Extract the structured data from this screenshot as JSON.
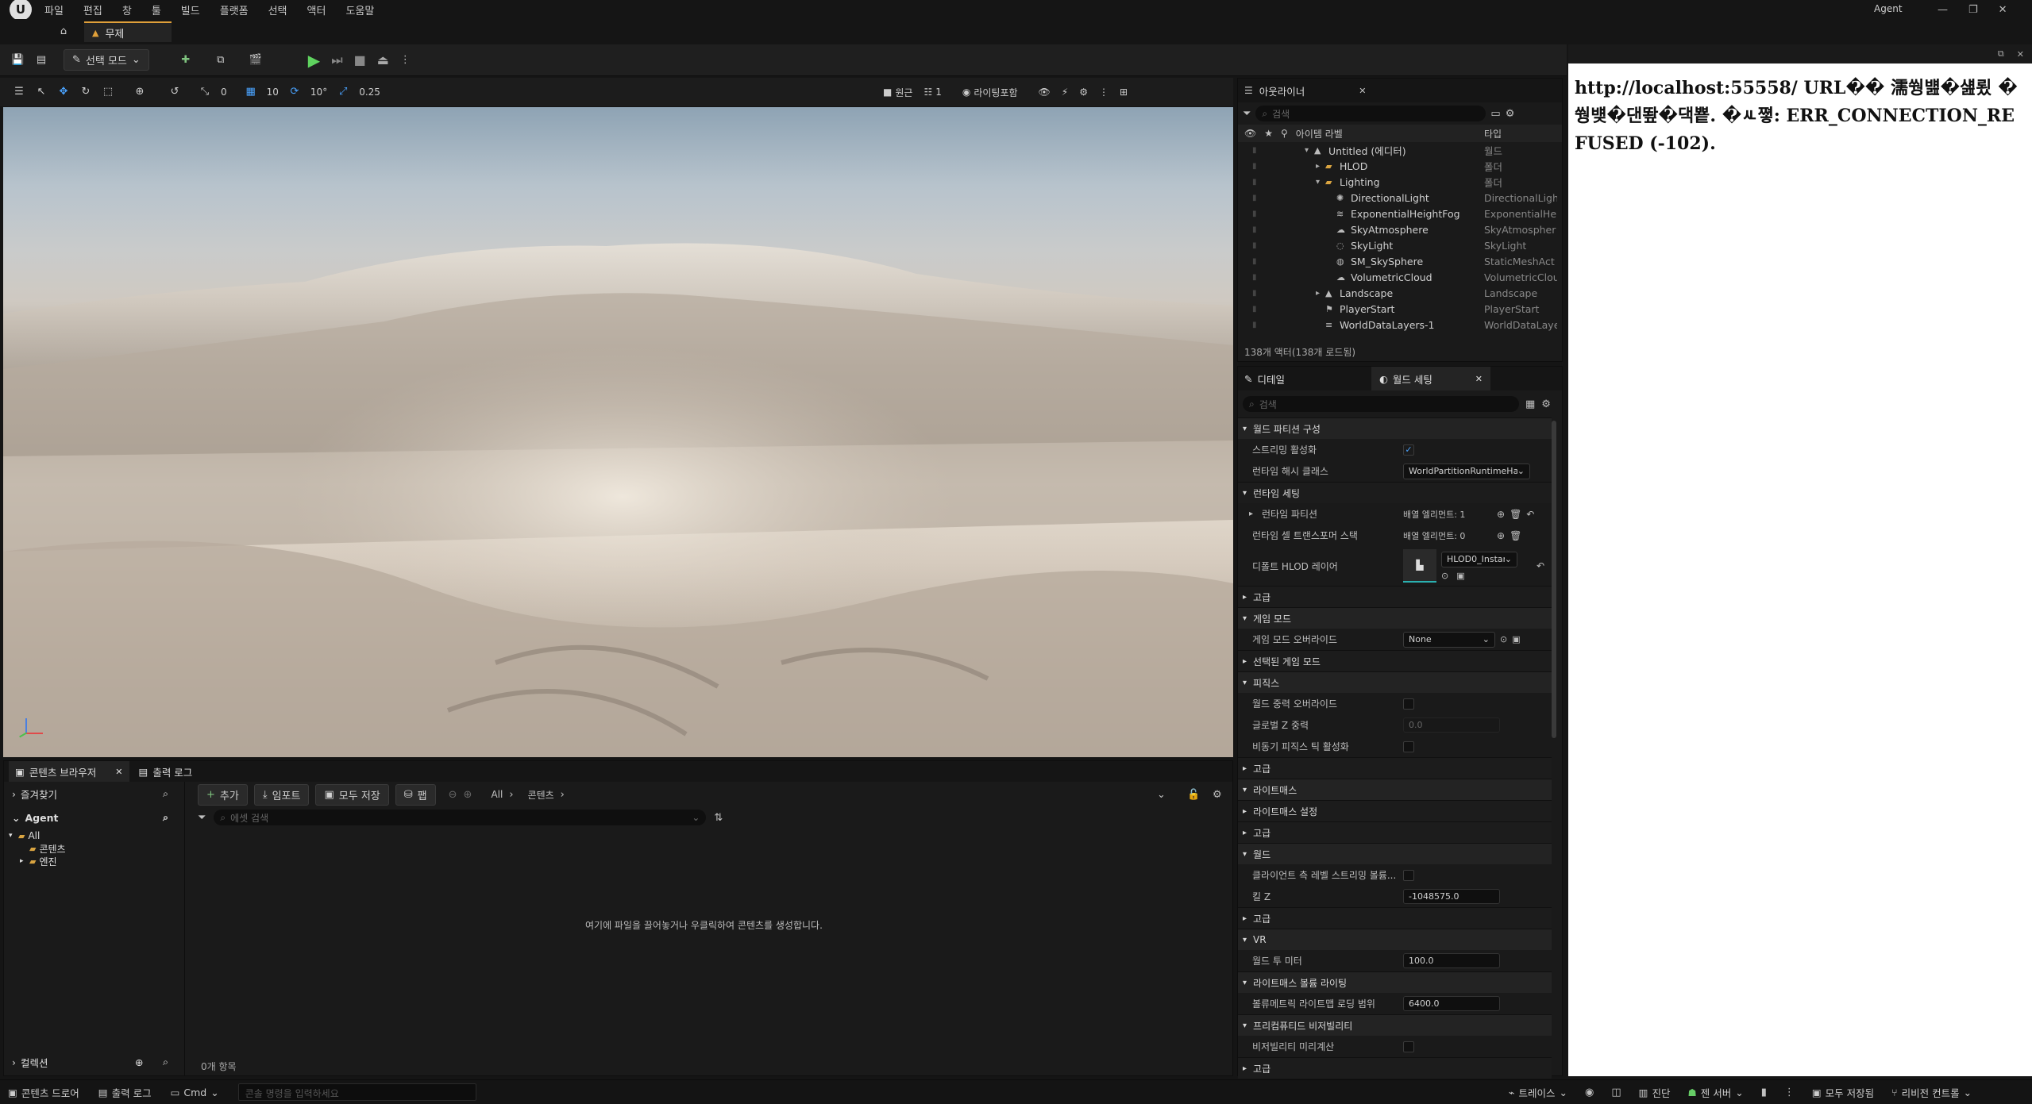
{
  "menu": [
    "파일",
    "편집",
    "창",
    "툴",
    "빌드",
    "플랫폼",
    "선택",
    "액터",
    "도움말"
  ],
  "window": {
    "user": "Agent",
    "level_tab": "무제"
  },
  "toolbar": {
    "mode_label": "선택 모드"
  },
  "viewport_toolbar": {
    "snap_move": "10",
    "snap_rotate": "10°",
    "snap_scale": "0.25",
    "cam_speed": "0",
    "perspective": "원근",
    "view_count": "1",
    "view_mode": "라이팅포함"
  },
  "outliner": {
    "tab_title": "아웃라이너",
    "search_placeholder": "검색",
    "col_label": "아이템 라벨",
    "col_type": "타입",
    "items": [
      {
        "label": "Untitled (에디터)",
        "type": "월드",
        "indent": 0,
        "icon": "world-icon",
        "exp": "down"
      },
      {
        "label": "HLOD",
        "type": "폴더",
        "indent": 1,
        "icon": "folder-icon",
        "exp": "right"
      },
      {
        "label": "Lighting",
        "type": "폴더",
        "indent": 1,
        "icon": "folder-icon",
        "exp": "down"
      },
      {
        "label": "DirectionalLight",
        "type": "DirectionalLight",
        "indent": 2,
        "icon": "sun-icon",
        "exp": ""
      },
      {
        "label": "ExponentialHeightFog",
        "type": "ExponentialHei",
        "indent": 2,
        "icon": "fog-icon",
        "exp": ""
      },
      {
        "label": "SkyAtmosphere",
        "type": "SkyAtmospher",
        "indent": 2,
        "icon": "atmosphere-icon",
        "exp": ""
      },
      {
        "label": "SkyLight",
        "type": "SkyLight",
        "indent": 2,
        "icon": "skylight-icon",
        "exp": ""
      },
      {
        "label": "SM_SkySphere",
        "type": "StaticMeshAct",
        "indent": 2,
        "icon": "mesh-icon",
        "exp": ""
      },
      {
        "label": "VolumetricCloud",
        "type": "VolumetricClou",
        "indent": 2,
        "icon": "cloud-icon",
        "exp": ""
      },
      {
        "label": "Landscape",
        "type": "Landscape",
        "indent": 1,
        "icon": "landscape-icon",
        "exp": "right"
      },
      {
        "label": "PlayerStart",
        "type": "PlayerStart",
        "indent": 1,
        "icon": "player-icon",
        "exp": ""
      },
      {
        "label": "WorldDataLayers-1",
        "type": "WorldDataLaye",
        "indent": 1,
        "icon": "layers-icon",
        "exp": ""
      }
    ],
    "footer": "138개 액터(138개 로드됨)"
  },
  "details": {
    "tab_details": "디테일",
    "tab_world": "월드 세팅",
    "search_placeholder": "검색",
    "rows": [
      {
        "kind": "cat",
        "label": "월드 파티션 구성",
        "open": true
      },
      {
        "kind": "prop",
        "label": "스트리밍 활성화",
        "ctrl": "checkbox",
        "checked": true
      },
      {
        "kind": "prop",
        "label": "런타임 해시 클래스",
        "ctrl": "dropdown",
        "value": "WorldPartitionRuntimeHa"
      },
      {
        "kind": "sub",
        "label": "런타임 세팅",
        "open": true
      },
      {
        "kind": "prop",
        "label": "런타임 파티션",
        "ctrl": "array",
        "value": "배열 엘리먼트: 1",
        "expandable": true
      },
      {
        "kind": "prop",
        "label": "런타임 셀 트랜스포머 스택",
        "ctrl": "array",
        "value": "배열 엘리먼트: 0"
      },
      {
        "kind": "prop-tall",
        "label": "디폴트 HLOD 레이어",
        "ctrl": "asset",
        "value": "HLOD0_Instan"
      },
      {
        "kind": "sub",
        "label": "고급",
        "open": false
      },
      {
        "kind": "cat",
        "label": "게임 모드",
        "open": true
      },
      {
        "kind": "prop",
        "label": "게임 모드 오버라이드",
        "ctrl": "dropdown-sm",
        "value": "None"
      },
      {
        "kind": "sub",
        "label": "선택된 게임 모드",
        "open": false
      },
      {
        "kind": "cat",
        "label": "피직스",
        "open": true
      },
      {
        "kind": "prop",
        "label": "월드 중력 오버라이드",
        "ctrl": "checkbox",
        "checked": false
      },
      {
        "kind": "prop",
        "label": "글로벌 Z 중력",
        "ctrl": "field-dim",
        "value": "0.0"
      },
      {
        "kind": "prop",
        "label": "비동기 피직스 틱 활성화",
        "ctrl": "checkbox",
        "checked": false
      },
      {
        "kind": "sub",
        "label": "고급",
        "open": false
      },
      {
        "kind": "cat",
        "label": "라이트매스",
        "open": true
      },
      {
        "kind": "sub",
        "label": "라이트매스 설정",
        "open": false
      },
      {
        "kind": "sub",
        "label": "고급",
        "open": false
      },
      {
        "kind": "cat",
        "label": "월드",
        "open": true
      },
      {
        "kind": "prop",
        "label": "클라이언트 측 레벨 스트리밍 볼륨...",
        "ctrl": "checkbox",
        "checked": false
      },
      {
        "kind": "prop",
        "label": "킬 Z",
        "ctrl": "field",
        "value": "-1048575.0"
      },
      {
        "kind": "sub",
        "label": "고급",
        "open": false
      },
      {
        "kind": "cat",
        "label": "VR",
        "open": true
      },
      {
        "kind": "prop",
        "label": "월드 투 미터",
        "ctrl": "field",
        "value": "100.0"
      },
      {
        "kind": "cat",
        "label": "라이트매스 볼륨 라이팅",
        "open": true
      },
      {
        "kind": "prop",
        "label": "볼류메트릭 라이트맵 로딩 범위",
        "ctrl": "field",
        "value": "6400.0"
      },
      {
        "kind": "cat",
        "label": "프리컴퓨티드 비저빌리티",
        "open": true
      },
      {
        "kind": "prop",
        "label": "비저빌리티 미리계산",
        "ctrl": "checkbox",
        "checked": false
      },
      {
        "kind": "sub",
        "label": "고급",
        "open": false
      }
    ]
  },
  "browser": {
    "tab_content": "콘텐츠 브라우저",
    "tab_log": "출력 로그",
    "favorites": "즐겨찾기",
    "project": "Agent",
    "tree": [
      {
        "label": "All",
        "indent": 0,
        "exp": "down"
      },
      {
        "label": "콘텐츠",
        "indent": 1,
        "exp": ""
      },
      {
        "label": "엔진",
        "indent": 1,
        "exp": "right"
      }
    ],
    "collections": "컬렉션",
    "add": "추가",
    "import": "임포트",
    "save_all": "모두 저장",
    "pane": "팹",
    "path_all": "All",
    "path_content": "콘텐츠",
    "search_placeholder": "에셋 검색",
    "empty_text": "여기에 파일을 끌어놓거나 우클릭하여 콘텐츠를 생성합니다.",
    "count": "0개 항목"
  },
  "statusbar": {
    "drawer": "콘텐츠 드로어",
    "log": "출력 로그",
    "cmd": "Cmd",
    "console_placeholder": "콘솔 명령을 입력하세요",
    "trace": "트레이스",
    "derived": "진단",
    "server": "젠 서버",
    "save_all": "모두 저장됨",
    "revision": "리비전 컨트롤"
  },
  "webview": {
    "error_text": "http://localhost:55558/ URL�� 濡쒕뱶�섎룄 �쒕뱾�댄뙆�댁뿉. �ㅻ쪟: ERR_CONNECTION_REFUSED (-102)."
  }
}
